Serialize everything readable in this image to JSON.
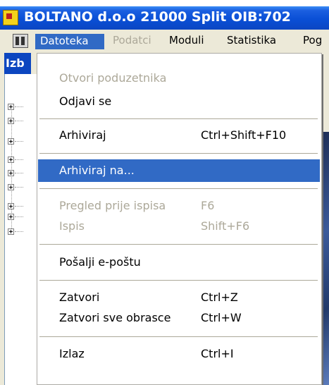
{
  "window": {
    "title": "BOLTANO d.o.o 21000 Split OIB:702"
  },
  "menubar": {
    "items": [
      {
        "label": "Datoteka"
      },
      {
        "label": "Podatci"
      },
      {
        "label": "Moduli"
      },
      {
        "label": "Statistika"
      },
      {
        "label": "Pog"
      }
    ]
  },
  "sidebar": {
    "header": "Izb"
  },
  "file_menu": {
    "items": [
      {
        "label": "Otvori poduzetnika",
        "shortcut": ""
      },
      {
        "label": "Odjavi se",
        "shortcut": ""
      },
      {
        "label": "Arhiviraj",
        "shortcut": "Ctrl+Shift+F10"
      },
      {
        "label": "Arhiviraj na...",
        "shortcut": ""
      },
      {
        "label": "Pregled prije ispisa",
        "shortcut": "F6"
      },
      {
        "label": "Ispis",
        "shortcut": "Shift+F6"
      },
      {
        "label": "Pošalji e-poštu",
        "shortcut": ""
      },
      {
        "label": "Zatvori",
        "shortcut": "Ctrl+Z"
      },
      {
        "label": "Zatvori sve obrasce",
        "shortcut": "Ctrl+W"
      },
      {
        "label": "Izlaz",
        "shortcut": "Ctrl+I"
      }
    ]
  }
}
